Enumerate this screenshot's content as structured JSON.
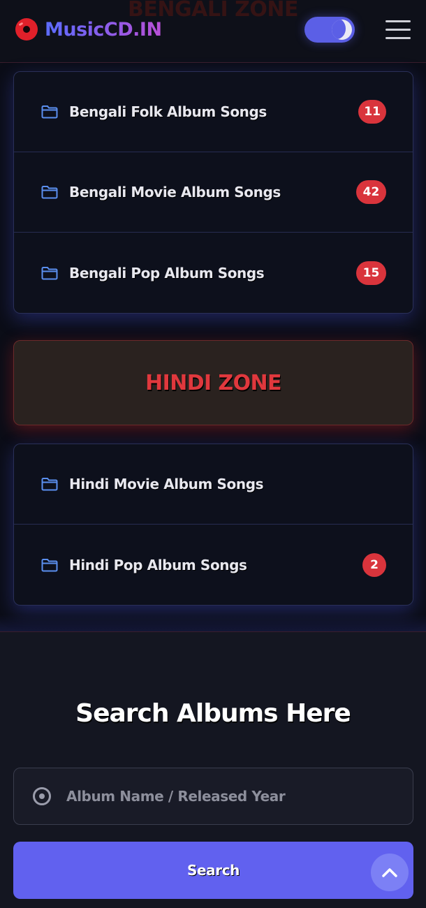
{
  "header": {
    "ghost_zone_title": "BENGALI ZONE",
    "logo_text": "MusicCD.IN",
    "theme_toggle": "dark-mode-toggle",
    "menu_icon": "hamburger-menu-icon"
  },
  "bengali_zone": {
    "items": [
      {
        "label": "Bengali Folk Album Songs",
        "count": "11"
      },
      {
        "label": "Bengali Movie Album Songs",
        "count": "42"
      },
      {
        "label": "Bengali Pop Album Songs",
        "count": "15"
      }
    ]
  },
  "hindi_zone": {
    "title": "HINDI ZONE",
    "items": [
      {
        "label": "Hindi Movie Album Songs",
        "count": ""
      },
      {
        "label": "Hindi Pop Album Songs",
        "count": "2"
      }
    ]
  },
  "search": {
    "heading": "Search Albums Here",
    "placeholder": "Album Name / Released Year",
    "button_label": "Search",
    "field_icon": "disc-icon"
  },
  "scroll_top_icon": "chevron-up-icon",
  "colors": {
    "background": "#0b0d17",
    "card_border": "#2a3058",
    "badge": "#d9343c",
    "zone_title": "#e0383d",
    "accent": "#6161ef",
    "folder_icon": "#5b8ff0"
  }
}
